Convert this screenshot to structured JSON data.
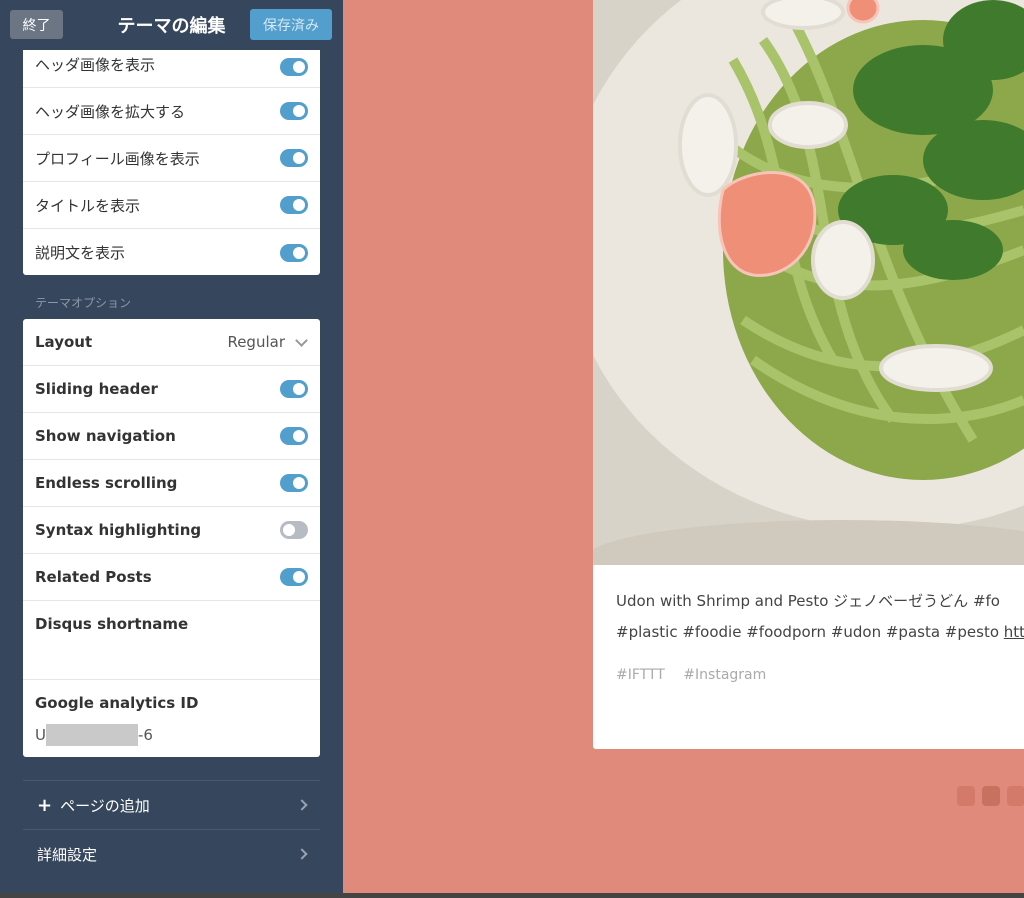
{
  "topbar": {
    "exit_label": "終了",
    "title": "テーマの編集",
    "saved_label": "保存済み"
  },
  "appearance_options": [
    {
      "label": "ヘッダ画像を表示",
      "on": true
    },
    {
      "label": "ヘッダ画像を拡大する",
      "on": true
    },
    {
      "label": "プロフィール画像を表示",
      "on": true
    },
    {
      "label": "タイトルを表示",
      "on": true
    },
    {
      "label": "説明文を表示",
      "on": true
    }
  ],
  "theme_options": {
    "section_label": "テーマオプション",
    "layout": {
      "label": "Layout",
      "value": "Regular"
    },
    "toggles": [
      {
        "label": "Sliding header",
        "on": true
      },
      {
        "label": "Show navigation",
        "on": true
      },
      {
        "label": "Endless scrolling",
        "on": true
      },
      {
        "label": "Syntax highlighting",
        "on": false
      },
      {
        "label": "Related Posts",
        "on": true
      }
    ],
    "disqus": {
      "label": "Disqus shortname",
      "value": ""
    },
    "google_analytics": {
      "label": "Google analytics ID",
      "value_prefix": "U",
      "value_suffix": "-6"
    }
  },
  "nav": {
    "add_page_label": "ページの追加",
    "advanced_label": "詳細設定"
  },
  "post": {
    "caption_line1": "Udon with Shrimp and Pesto ジェノベーゼうどん #fo",
    "caption_line2_text": "#plastic #foodie #foodporn #udon #pasta #pesto ",
    "caption_link": "http",
    "tags": [
      "#IFTTT",
      "#Instagram"
    ]
  },
  "colors": {
    "sidebar_bg": "#36465d",
    "accent": "#529ecc",
    "page_bg": "#e08a7b"
  }
}
